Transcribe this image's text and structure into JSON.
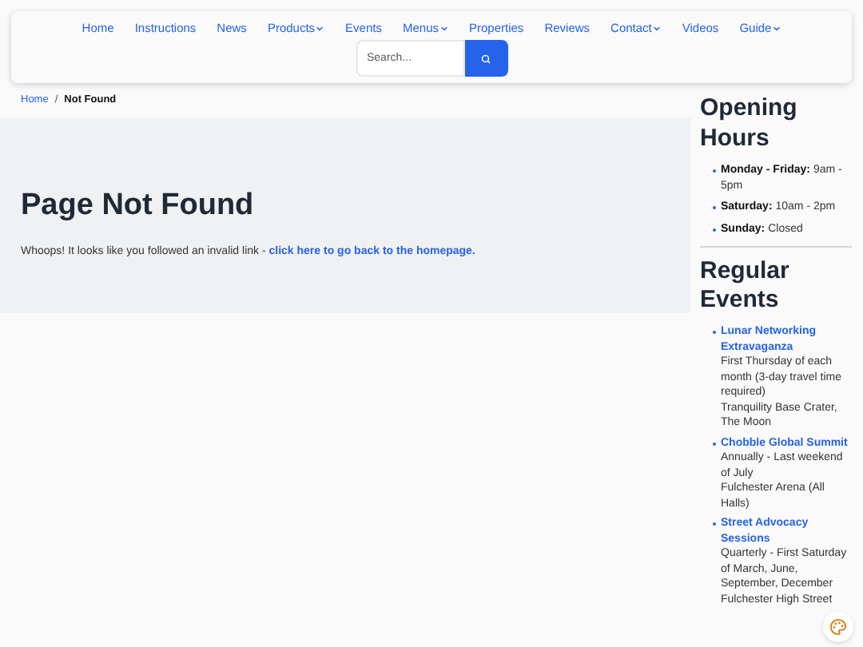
{
  "nav": {
    "items": [
      {
        "label": "Home",
        "dropdown": false
      },
      {
        "label": "Instructions",
        "dropdown": false
      },
      {
        "label": "News",
        "dropdown": false
      },
      {
        "label": "Products",
        "dropdown": true
      },
      {
        "label": "Events",
        "dropdown": false
      },
      {
        "label": "Menus",
        "dropdown": true
      },
      {
        "label": "Properties",
        "dropdown": false
      },
      {
        "label": "Reviews",
        "dropdown": false
      },
      {
        "label": "Contact",
        "dropdown": true
      },
      {
        "label": "Videos",
        "dropdown": false
      },
      {
        "label": "Guide",
        "dropdown": true
      }
    ],
    "search": {
      "placeholder": "Search..."
    }
  },
  "breadcrumb": [
    {
      "label": "Home",
      "link": true
    },
    {
      "label": "/",
      "link": false
    },
    {
      "label": "Not Found",
      "link": false
    }
  ],
  "main": {
    "title": "Page Not Found",
    "text": "Whoops! It looks like you followed an invalid link - ",
    "link": "click here to go back to the homepage."
  },
  "sidebar": {
    "hours_title": "Opening Hours",
    "hours": [
      {
        "day": "Monday - Friday:",
        "time": "9am - 5pm"
      },
      {
        "day": "Saturday:",
        "time": "10am - 2pm"
      },
      {
        "day": "Sunday:",
        "time": "Closed"
      }
    ],
    "events_title": "Regular Events",
    "events": [
      {
        "name": "Lunar Networking Extravaganza",
        "schedule": "First Thursday of each month (3-day travel time required)",
        "location": "Tranquility Base Crater, The Moon"
      },
      {
        "name": "Chobble Global Summit",
        "schedule": "Annually - Last weekend of July",
        "location": "Fulchester Arena (All Halls)"
      },
      {
        "name": "Street Advocacy Sessions",
        "schedule": "Quarterly - First Saturday of March, June, September, December",
        "location": "Fulchester High Street"
      }
    ]
  }
}
